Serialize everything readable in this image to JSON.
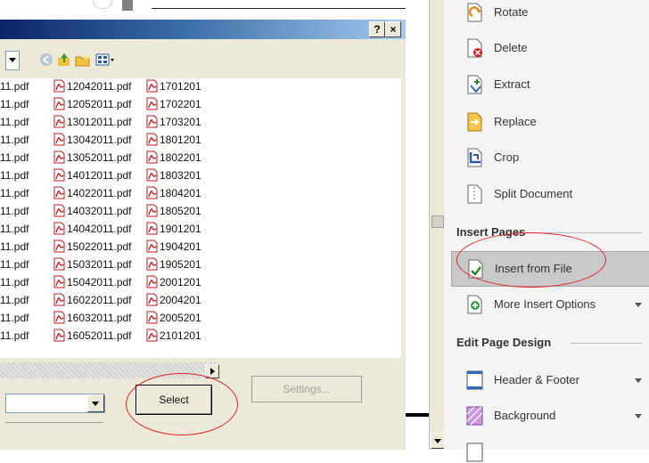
{
  "dialog": {
    "title_buttons": [
      "?",
      "×"
    ],
    "files": [
      [
        "11.pdf",
        "12042011.pdf",
        "1701201"
      ],
      [
        "11.pdf",
        "12052011.pdf",
        "1702201"
      ],
      [
        "11.pdf",
        "13012011.pdf",
        "1703201"
      ],
      [
        "11.pdf",
        "13042011.pdf",
        "1801201"
      ],
      [
        "11.pdf",
        "13052011.pdf",
        "1802201"
      ],
      [
        "11.pdf",
        "14012011.pdf",
        "1803201"
      ],
      [
        "11.pdf",
        "14022011.pdf",
        "1804201"
      ],
      [
        "11.pdf",
        "14032011.pdf",
        "1805201"
      ],
      [
        "11.pdf",
        "14042011.pdf",
        "1901201"
      ],
      [
        "11.pdf",
        "15022011.pdf",
        "1904201"
      ],
      [
        "11.pdf",
        "15032011.pdf",
        "1905201"
      ],
      [
        "11.pdf",
        "15042011.pdf",
        "2001201"
      ],
      [
        "11.pdf",
        "16022011.pdf",
        "2004201"
      ],
      [
        "11.pdf",
        "16032011.pdf",
        "2005201"
      ],
      [
        "11.pdf",
        "16052011.pdf",
        "2101201"
      ]
    ],
    "settings_label": "Settings...",
    "select_label": "Select"
  },
  "panel": {
    "page_tools": [
      "Rotate",
      "Delete",
      "Extract",
      "Replace",
      "Crop",
      "Split Document"
    ],
    "insert_section": "Insert Pages",
    "insert_items": [
      "Insert from File",
      "More Insert Options"
    ],
    "design_section": "Edit Page Design",
    "design_items": [
      "Header & Footer",
      "Background"
    ]
  },
  "colors": {
    "annotation": "#e0222a",
    "selected_item": "#c9c9c9",
    "pdf_icon": "#c01818"
  }
}
